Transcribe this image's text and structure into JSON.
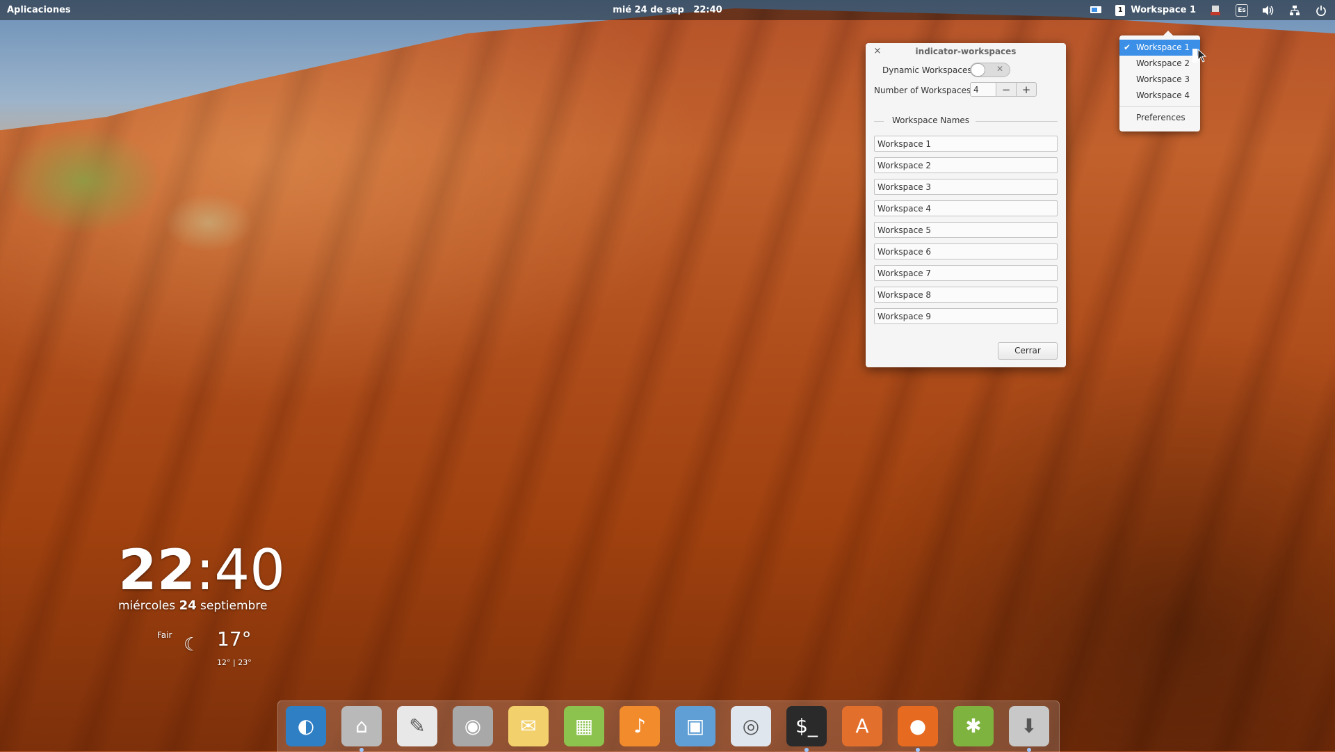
{
  "top_panel": {
    "applications_label": "Aplicaciones",
    "clock": "mié 24 de sep   22:40",
    "workspace_badge": "1",
    "workspace_label": "Workspace 1",
    "keyboard_label": "Es"
  },
  "workspace_menu": {
    "items": [
      {
        "label": "Workspace 1",
        "checked": true
      },
      {
        "label": "Workspace 2",
        "checked": false
      },
      {
        "label": "Workspace 3",
        "checked": false
      },
      {
        "label": "Workspace 4",
        "checked": false
      }
    ],
    "preferences_label": "Preferences"
  },
  "dialog": {
    "title": "indicator-workspaces",
    "close_glyph": "×",
    "dynamic_label": "Dynamic Workspaces",
    "dynamic_enabled": false,
    "number_label": "Number of Workspaces",
    "number_value": "4",
    "minus_glyph": "−",
    "plus_glyph": "+",
    "section_title": "Workspace Names",
    "names": [
      "Workspace 1",
      "Workspace 2",
      "Workspace 3",
      "Workspace 4",
      "Workspace 5",
      "Workspace 6",
      "Workspace 7",
      "Workspace 8",
      "Workspace 9"
    ],
    "close_button": "Cerrar"
  },
  "desktop_clock": {
    "hours": "22",
    "minutes": "40",
    "weekday": "miércoles",
    "day": "24",
    "month": "septiembre"
  },
  "weather": {
    "condition": "Fair",
    "temperature": "17°",
    "range": "12° | 23°"
  },
  "dock": {
    "items": [
      {
        "name": "midori-browser-icon",
        "glyph": "◐",
        "bg": "#2f7fc4",
        "running": false
      },
      {
        "name": "files-icon",
        "glyph": "⌂",
        "bg": "#b9b9b9",
        "running": true
      },
      {
        "name": "text-editor-icon",
        "glyph": "✎",
        "bg": "#e8e8e8",
        "running": false
      },
      {
        "name": "camera-icon",
        "glyph": "◉",
        "bg": "#a8a8a8",
        "running": false
      },
      {
        "name": "mail-icon",
        "glyph": "✉",
        "bg": "#f2d06b",
        "running": false
      },
      {
        "name": "calendar-icon",
        "glyph": "▦",
        "bg": "#8cc34f",
        "running": false
      },
      {
        "name": "music-icon",
        "glyph": "♪",
        "bg": "#f28b2b",
        "running": false
      },
      {
        "name": "photos-icon",
        "glyph": "▣",
        "bg": "#5f9fd6",
        "running": false
      },
      {
        "name": "settings-icon",
        "glyph": "◎",
        "bg": "#dfe6ee",
        "running": false
      },
      {
        "name": "terminal-icon",
        "glyph": "$_",
        "bg": "#2a2a2a",
        "running": true
      },
      {
        "name": "software-center-icon",
        "glyph": "A",
        "bg": "#e36f2c",
        "running": false
      },
      {
        "name": "firefox-icon",
        "glyph": "●",
        "bg": "#e66a1f",
        "running": true
      },
      {
        "name": "bug-icon",
        "glyph": "✱",
        "bg": "#7fb33f",
        "running": false
      },
      {
        "name": "installer-icon",
        "glyph": "⬇",
        "bg": "#c8c8c8",
        "running": true
      }
    ]
  },
  "colors": {
    "accent": "#3b8fe6",
    "panel_bg": "rgba(10,10,10,0.45)",
    "dialog_bg": "#f5f5f5"
  }
}
